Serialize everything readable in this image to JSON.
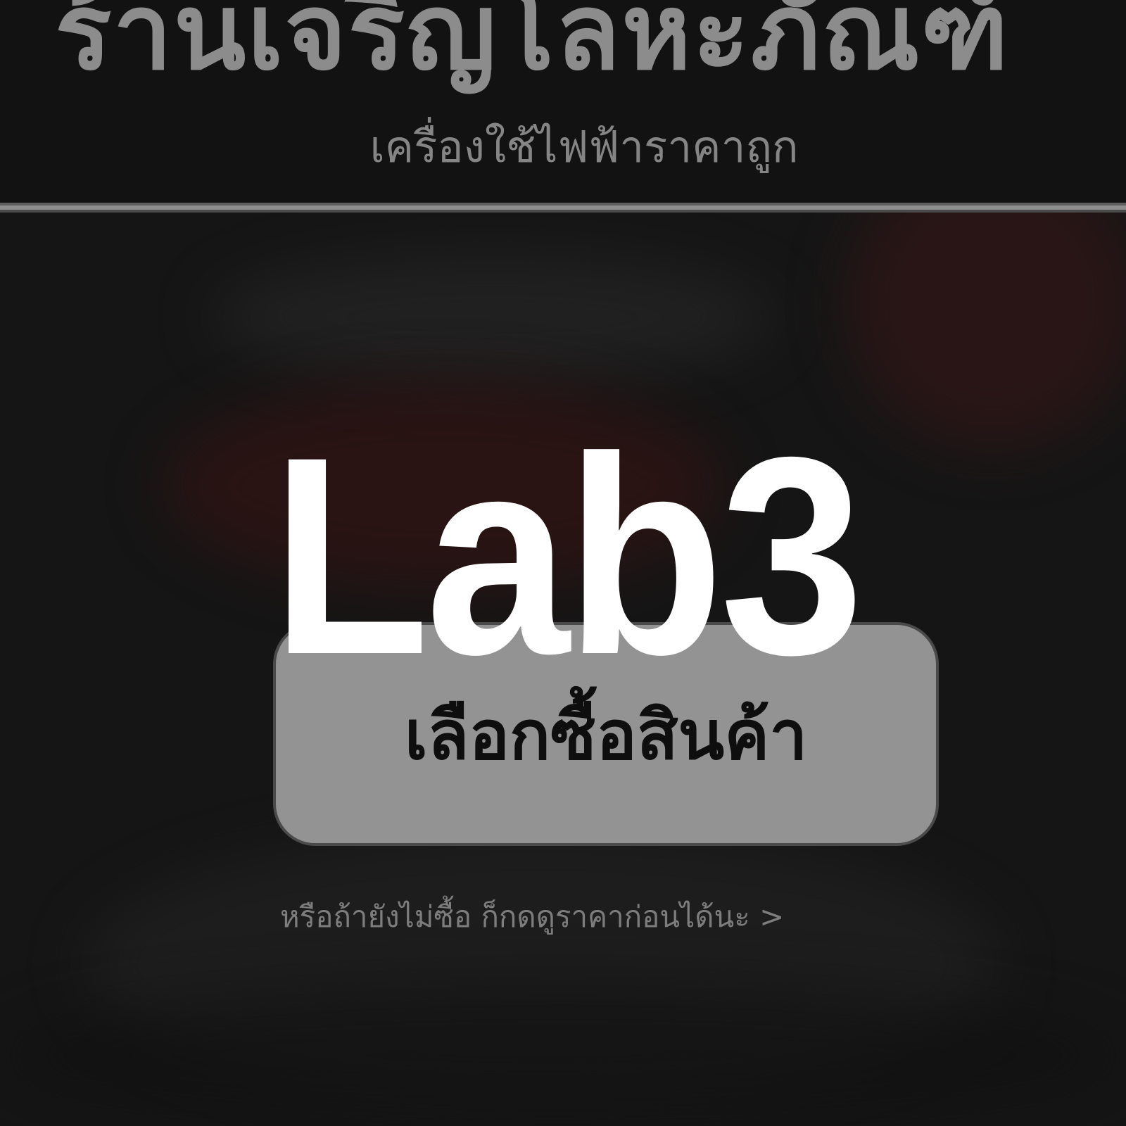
{
  "header": {
    "shop_name": "ร้านเจริญโลหะภัณฑ์",
    "tagline": "เครื่องใช้ไฟฟ้าราคาถูก"
  },
  "main": {
    "buy_button_label": "เลือกซื้อสินค้า",
    "browse_link_text": "หรือถ้ายังไม่ซื้อ ก็กดดูราคาก่อนได้นะ >"
  },
  "overlay": {
    "label": "Lab3"
  },
  "colors": {
    "page_background": "#151515",
    "header_text": "#8c8c8c",
    "button_background": "#939393",
    "button_text": "#0e0e0e",
    "overlay_text": "#ffffff"
  }
}
